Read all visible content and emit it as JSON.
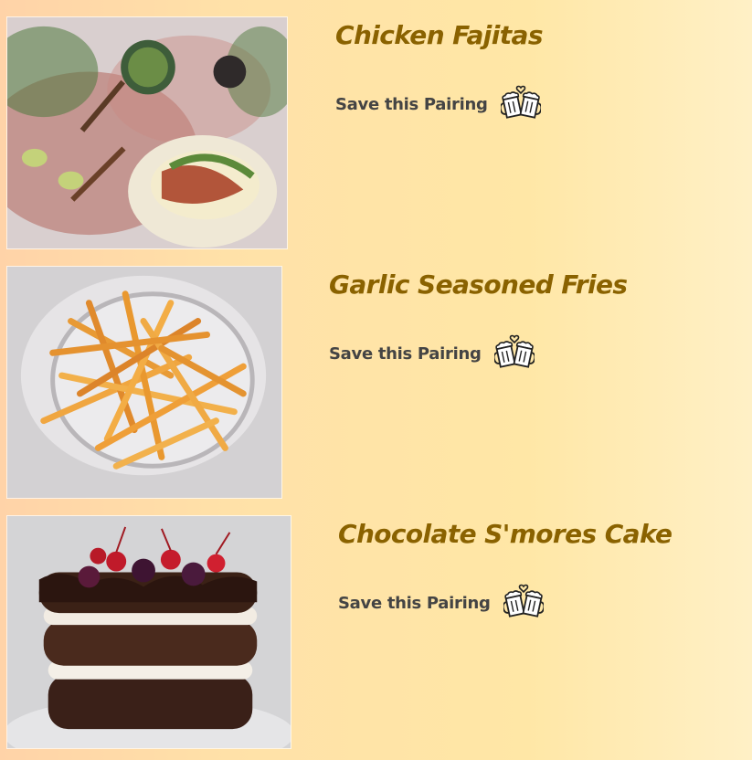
{
  "pairings": [
    {
      "title": "Chicken Fajitas",
      "save_label": "Save this Pairing",
      "photo_icon": "fajitas-photo",
      "save_icon": "cheers-mugs-icon"
    },
    {
      "title": "Garlic Seasoned Fries",
      "save_label": "Save this Pairing",
      "photo_icon": "fries-photo",
      "save_icon": "cheers-mugs-icon"
    },
    {
      "title": "Chocolate S'mores Cake",
      "save_label": "Save this Pairing",
      "photo_icon": "cake-photo",
      "save_icon": "cheers-mugs-icon"
    }
  ],
  "colors": {
    "title": "#8a6200",
    "save_label": "#444444"
  }
}
